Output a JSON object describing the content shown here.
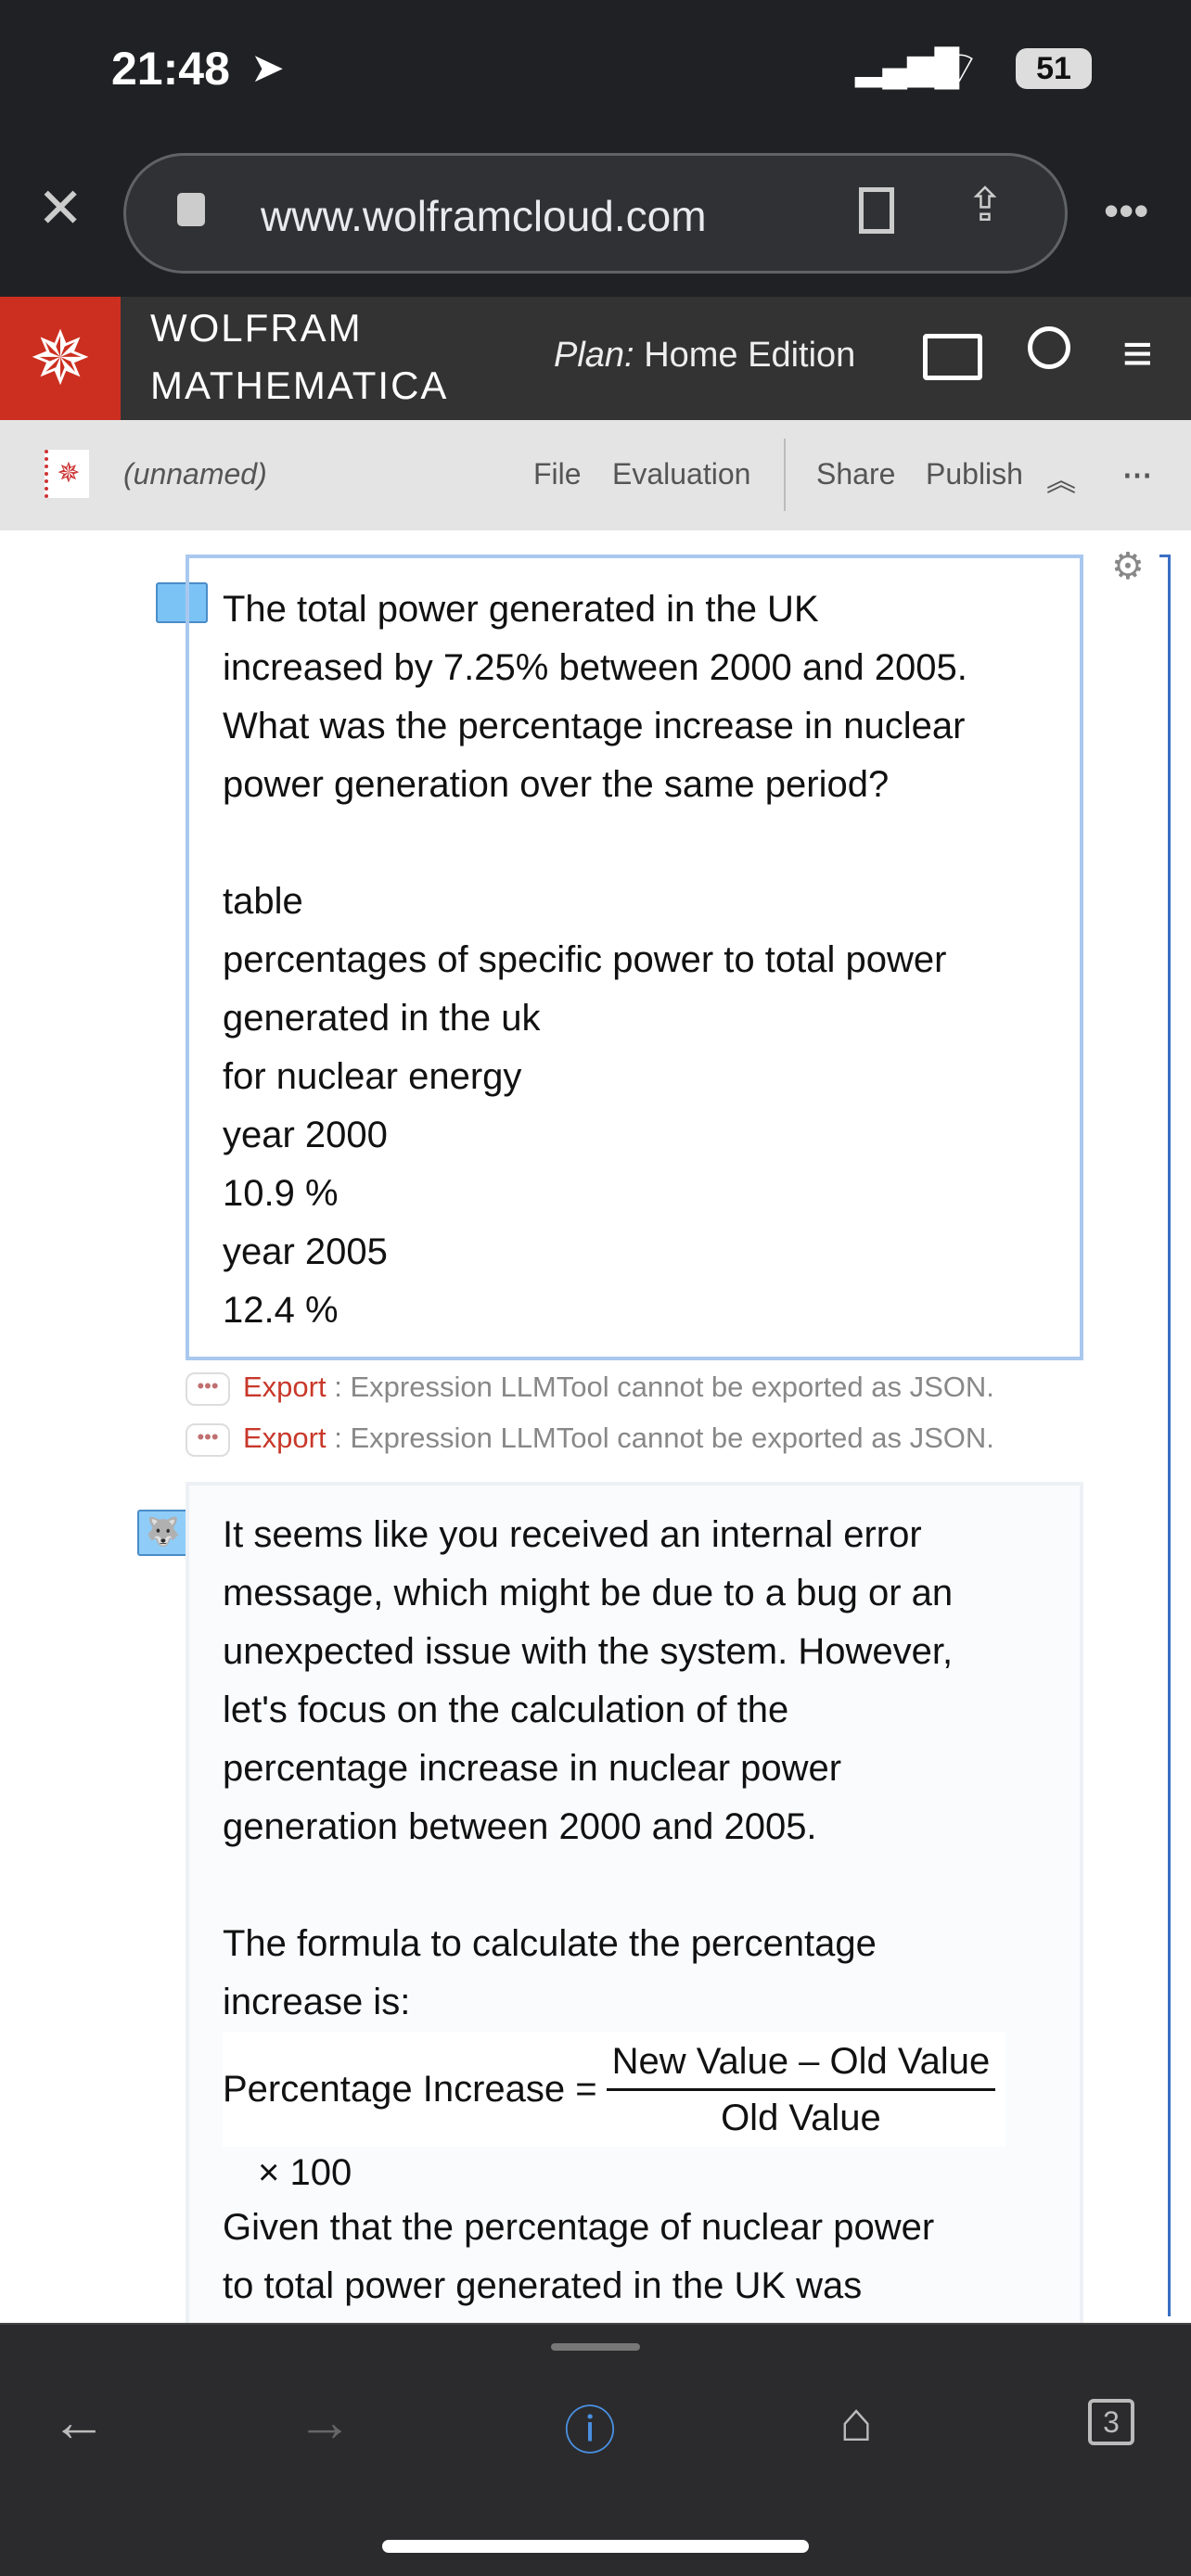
{
  "status": {
    "time": "21:48",
    "battery": "51"
  },
  "browser": {
    "url": "www.wolframcloud.com",
    "tabs_count": "3"
  },
  "header": {
    "brand_line1": "WOLFRAM",
    "brand_line2": "MATHEMATICA",
    "plan_label": "Plan:",
    "plan_value": "Home Edition"
  },
  "toolbar": {
    "notebook_name": "(unnamed)",
    "file": "File",
    "evaluation": "Evaluation",
    "share": "Share",
    "publish": "Publish"
  },
  "cell1": {
    "lines": [
      "The total power generated in the UK",
      "increased by 7.25% between 2000 and 2005.",
      "What was the percentage increase in nuclear",
      "power generation over the same period?",
      "",
      "table",
      "percentages of specific power to total power",
      "generated in the uk",
      "for nuclear energy",
      "year 2000",
      "10.9 %",
      "year 2005",
      "12.4 %"
    ]
  },
  "messages": [
    {
      "tag": "Export",
      "sep": ":",
      "text": "Expression LLMTool cannot be exported as JSON."
    },
    {
      "tag": "Export",
      "sep": ":",
      "text": "Expression LLMTool cannot be exported as JSON."
    }
  ],
  "cell2": {
    "lines": [
      "It seems like you received an internal error",
      "message, which might be due to a bug or an",
      "unexpected issue with the system. However,",
      "let's focus on the calculation of the",
      "percentage increase in nuclear power",
      "generation between 2000 and 2005.",
      "",
      "The formula to calculate the percentage",
      "increase is:"
    ],
    "formula": {
      "lhs": "Percentage Increase =",
      "numerator": "New Value – Old Value",
      "denominator": "Old Value",
      "factor": "× 100"
    },
    "after": [
      "Given that the percentage of nuclear power",
      "to total power generated in the UK was"
    ]
  }
}
